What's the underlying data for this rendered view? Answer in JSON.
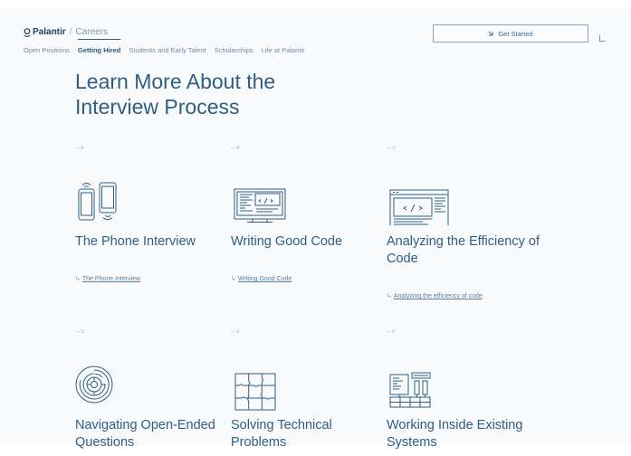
{
  "header": {
    "brand": "Palantir",
    "separator": "/",
    "section": "Careers",
    "cta_label": "Get Started",
    "cta_icon": "arrow-icon"
  },
  "nav": {
    "items": [
      "Open Positions",
      "Getting Hired",
      "Students and Early Talent",
      "Scholarships",
      "Life at Palantir"
    ],
    "active": "Getting Hired"
  },
  "headline": "Learn More About the Interview Process",
  "cards": [
    {
      "letter": "— A",
      "title": "The Phone Interview",
      "link": "The Phone Interview",
      "icon": "phones-icon"
    },
    {
      "letter": "— B",
      "title": "Writing Good Code",
      "link": "Writing Good Code",
      "icon": "monitor-code-icon"
    },
    {
      "letter": "— C",
      "title": "Analyzing the Efficiency of Code",
      "link": "Analyzing the efficiency of code",
      "icon": "browser-code-icon"
    },
    {
      "letter": "— D",
      "title": "Navigating Open-Ended Questions",
      "link": "",
      "icon": "maze-icon"
    },
    {
      "letter": "— E",
      "title": "Solving Technical Problems",
      "link": "",
      "icon": "puzzle-icon"
    },
    {
      "letter": "— F",
      "title": "Working Inside Existing Systems",
      "link": "",
      "icon": "system-blocks-icon"
    }
  ],
  "colors": {
    "primary": "#2f5e86",
    "muted": "#9bb0c2",
    "background": "#f9fafb"
  }
}
